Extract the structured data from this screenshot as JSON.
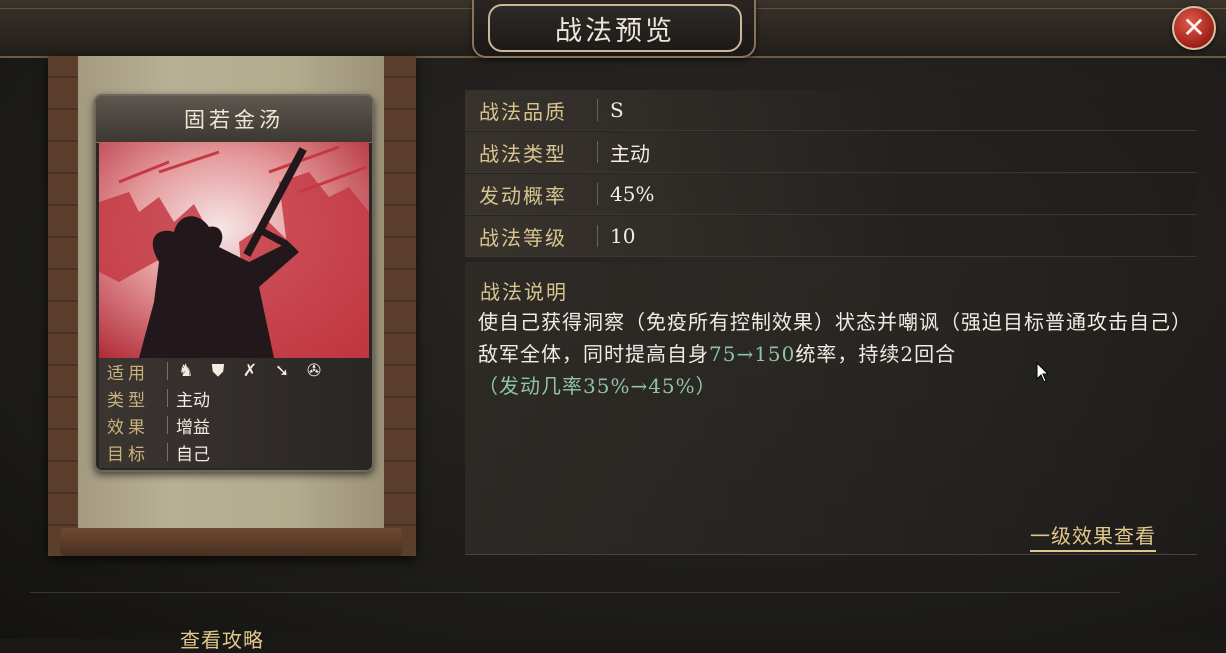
{
  "window": {
    "title": "战法预览",
    "close_icon": "✕"
  },
  "card": {
    "name": "固若金汤",
    "attributes": [
      {
        "key": "适用",
        "icons": [
          "cavalry-icon",
          "shield-icon",
          "bow-icon",
          "spear-icon",
          "wheel-icon"
        ]
      },
      {
        "key": "类型",
        "value": "主动"
      },
      {
        "key": "效果",
        "value": "增益"
      },
      {
        "key": "目标",
        "value": "自己"
      }
    ],
    "art_colors": {
      "primary": "#c0303a",
      "light": "#f3dede",
      "silhouette": "#1e1416"
    }
  },
  "info": {
    "rows": [
      {
        "key": "战法品质",
        "value": "S"
      },
      {
        "key": "战法类型",
        "value": "主动"
      },
      {
        "key": "发动概率",
        "value": "45%"
      },
      {
        "key": "战法等级",
        "value": "10"
      }
    ],
    "description_title": "战法说明",
    "description": {
      "part1": "使自己获得洞察（免疫所有控制效果）状态并嘲讽（强迫目标普通攻击自己）敌军全体，同时提高自身",
      "hl1": "75→150",
      "part2": "统率，持续2回合",
      "hl2": "（发动几率35%→45%）"
    },
    "level_effect_link": "一级效果查看"
  },
  "footer": {
    "guide_link": "查看攻略"
  },
  "colors": {
    "accent_gold": "#d8c48e",
    "highlight_green": "#8fc4a2",
    "close_red": "#b02820"
  }
}
